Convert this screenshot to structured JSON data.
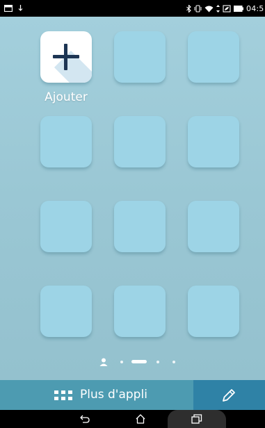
{
  "status_bar": {
    "time": "04:5",
    "icons": [
      "notification-box-icon",
      "download-icon",
      "bluetooth-icon",
      "vibrate-icon",
      "wifi-icon",
      "data-arrows-icon",
      "battery-saver-icon",
      "battery-icon"
    ]
  },
  "home": {
    "add_tile": {
      "label": "Ajouter",
      "icon": "plus-icon"
    },
    "empty_tile_count": 11,
    "pager": {
      "pages": 4,
      "current": 2,
      "first_is_people": true
    }
  },
  "dock": {
    "apps_label": "Plus d'appli",
    "apps_icon": "app-grid-icon",
    "edit_icon": "pencil-icon",
    "apps_color": "#4d9bb1",
    "edit_color": "#2f82a6"
  },
  "nav_bar": {
    "buttons": [
      "back-icon",
      "home-icon",
      "recents-icon"
    ]
  },
  "colors": {
    "wallpaper": "#9fcbd8",
    "tile": "#9dd4e6",
    "plus": "#1d3554"
  }
}
